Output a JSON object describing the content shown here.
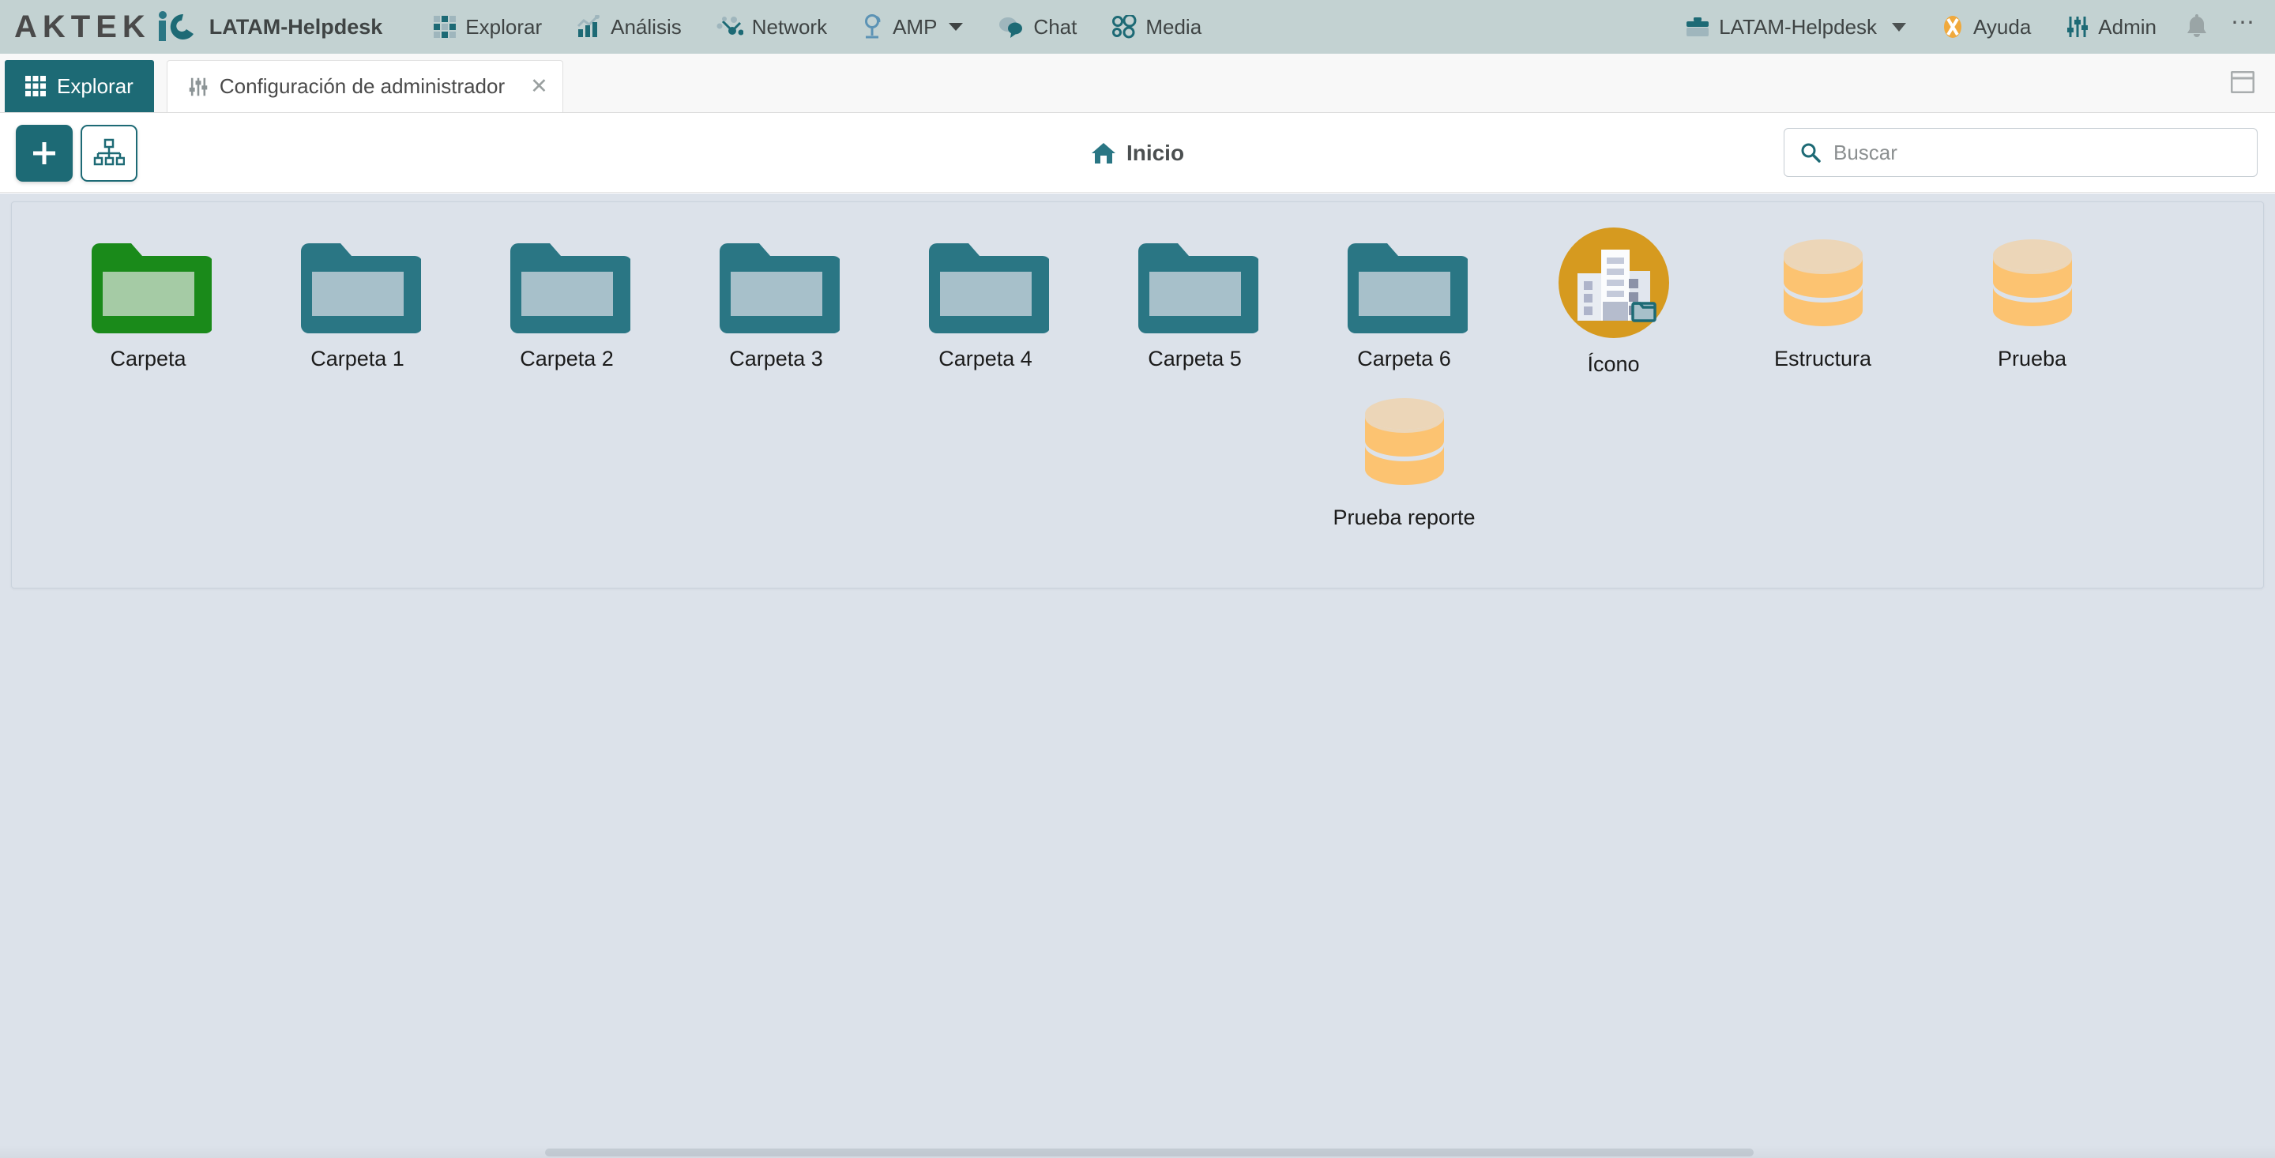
{
  "brand": {
    "logo_letters": "AKTEK",
    "logo_mark": "io-circle-logo",
    "title": "LATAM-Helpdesk"
  },
  "topnav": {
    "left_items": [
      {
        "label": "Explorar",
        "icon": "grid-icon"
      },
      {
        "label": "Análisis",
        "icon": "analytics-chart-icon"
      },
      {
        "label": "Network",
        "icon": "network-nodes-icon"
      },
      {
        "label": "AMP",
        "icon": "microscope-icon",
        "has_caret": true
      },
      {
        "label": "Chat",
        "icon": "chat-bubble-icon"
      },
      {
        "label": "Media",
        "icon": "media-circles-icon"
      }
    ],
    "right_items": [
      {
        "label": "LATAM-Helpdesk",
        "icon": "briefcase-icon",
        "has_caret": true
      },
      {
        "label": "Ayuda",
        "icon": "help-orange-icon"
      },
      {
        "label": "Admin",
        "icon": "sliders-icon"
      }
    ],
    "notifications_icon": "bell-icon",
    "overflow_label": "⋯"
  },
  "tabs": [
    {
      "label": "Explorar",
      "icon": "grid-icon",
      "active": true,
      "closable": false
    },
    {
      "label": "Configuración de administrador",
      "icon": "sliders-icon",
      "active": false,
      "closable": true,
      "close_glyph": "✕"
    }
  ],
  "tabstrip": {
    "panel_toggle_icon": "window-panel-icon"
  },
  "toolbar": {
    "add_button_label": "+",
    "add_button_icon": "plus-icon",
    "tree_button_icon": "hierarchy-tree-icon",
    "breadcrumb_icon": "home-icon",
    "breadcrumb_label": "Inicio"
  },
  "search": {
    "icon": "search-icon",
    "placeholder": "Buscar",
    "value": ""
  },
  "items": [
    {
      "label": "Carpeta",
      "type": "folder",
      "color": "#1a8a1a",
      "fill": "#a5cba5"
    },
    {
      "label": "Carpeta 1",
      "type": "folder",
      "color": "#2a7684",
      "fill": "#a7c0ca"
    },
    {
      "label": "Carpeta 2",
      "type": "folder",
      "color": "#2a7684",
      "fill": "#a7c0ca"
    },
    {
      "label": "Carpeta 3",
      "type": "folder",
      "color": "#2a7684",
      "fill": "#a7c0ca"
    },
    {
      "label": "Carpeta 4",
      "type": "folder",
      "color": "#2a7684",
      "fill": "#a7c0ca"
    },
    {
      "label": "Carpeta 5",
      "type": "folder",
      "color": "#2a7684",
      "fill": "#a7c0ca"
    },
    {
      "label": "Carpeta 6",
      "type": "folder",
      "color": "#2a7684",
      "fill": "#a7c0ca"
    },
    {
      "label": "Ícono",
      "type": "avatar-building",
      "color": "#d69a1f",
      "badge": "folder-badge"
    },
    {
      "label": "Estructura",
      "type": "database",
      "color": "#fcc371",
      "top": "#ecd6b8"
    },
    {
      "label": "Prueba",
      "type": "database",
      "color": "#fcc371",
      "top": "#ecd6b8"
    },
    {
      "label": "Prueba reporte",
      "type": "database",
      "color": "#fcc371",
      "top": "#ecd6b8"
    }
  ],
  "theme": {
    "topbar_bg": "#c3d2d2",
    "accent_teal": "#1d6a75",
    "content_bg": "#dce2ea",
    "folder_teal": "#2a7684",
    "folder_green": "#1a8a1a",
    "database_orange": "#fcc371",
    "avatar_gold": "#d69a1f"
  }
}
